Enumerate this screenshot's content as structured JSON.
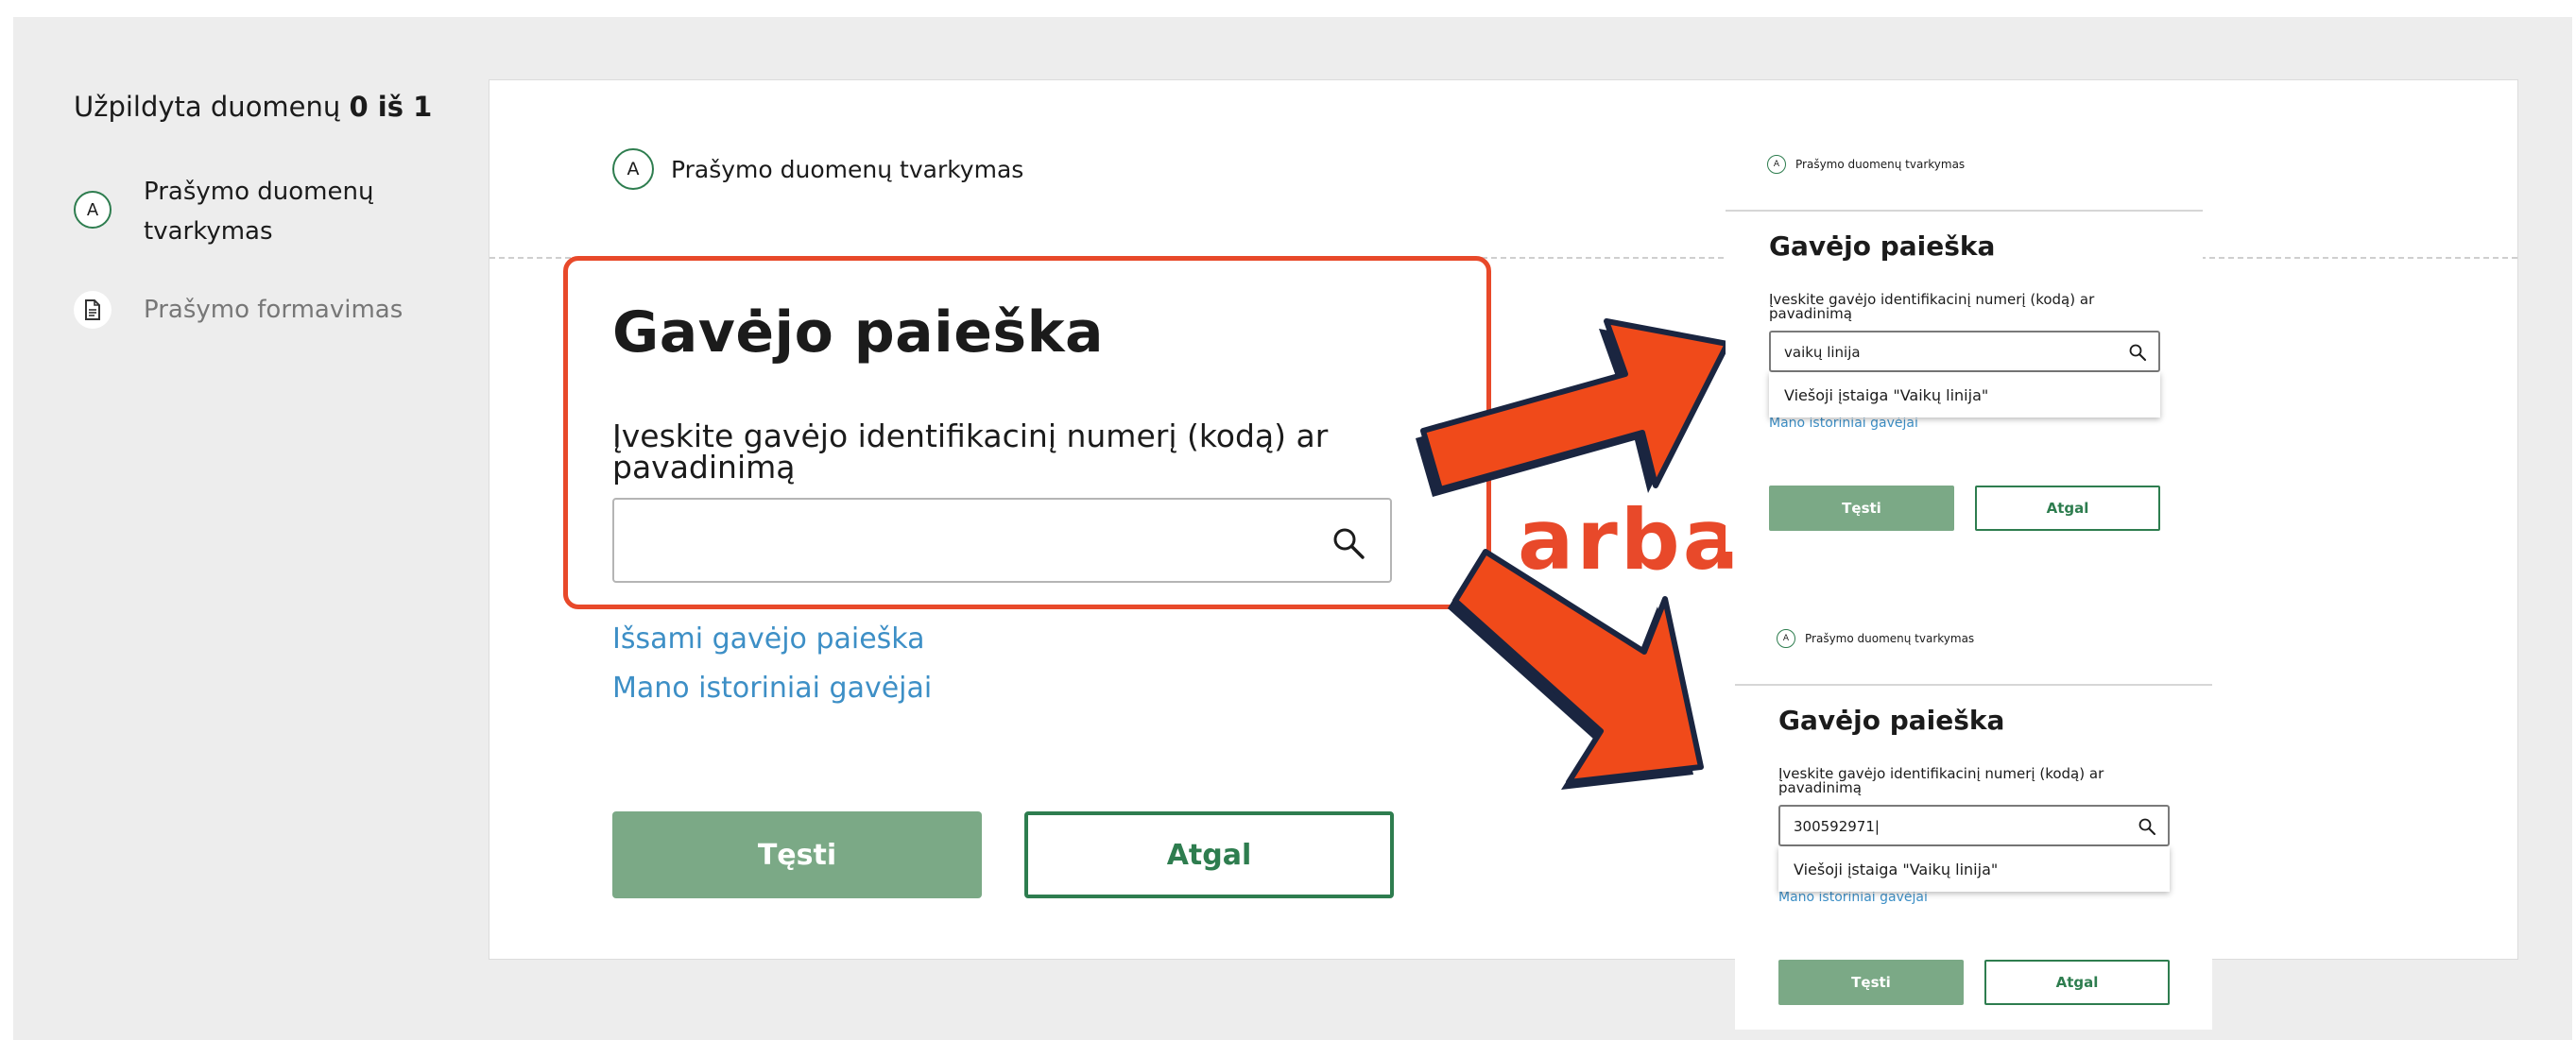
{
  "sidebar": {
    "progress_prefix": "Užpildyta duomenų",
    "progress_value": "0 iš 1",
    "steps": [
      {
        "badge": "A",
        "label": "Prašymo duomenų tvarkymas",
        "icon": "circle-a-icon"
      },
      {
        "label": "Prašymo formavimas",
        "icon": "document-icon"
      }
    ]
  },
  "main": {
    "step_badge": "A",
    "step_title": "Prašymo duomenų tvarkymas",
    "heading": "Gavėjo paieška",
    "field_label": "Įveskite gavėjo identifikacinį numerį (kodą) ar pavadinimą",
    "search_value": "",
    "links": [
      "Išsami gavėjo paieška",
      "Mano istoriniai gavėjai"
    ],
    "primary_button": "Tęsti",
    "secondary_button": "Atgal"
  },
  "annotation": {
    "text": "arba",
    "color": "#e8492a",
    "arrow_color": "#f04a1a",
    "arrow_outline": "#1a2540"
  },
  "previews": [
    {
      "step_badge": "A",
      "step_title": "Prašymo duomenų tvarkymas",
      "heading": "Gavėjo paieška",
      "field_label": "Įveskite gavėjo identifikacinį numerį (kodą) ar pavadinimą",
      "search_value": "vaikų linija",
      "suggestion": "Viešoji įstaiga \"Vaikų linija\"",
      "link": "Mano istoriniai gavėjai",
      "primary_button": "Tęsti",
      "secondary_button": "Atgal"
    },
    {
      "step_badge": "A",
      "step_title": "Prašymo duomenų tvarkymas",
      "heading": "Gavėjo paieška",
      "field_label": "Įveskite gavėjo identifikacinį numerį (kodą) ar pavadinimą",
      "search_value": "300592971|",
      "suggestion": "Viešoji įstaiga \"Vaikų linija\"",
      "link": "Mano istoriniai gavėjai",
      "primary_button": "Tęsti",
      "secondary_button": "Atgal"
    }
  ],
  "colors": {
    "accent_green": "#2e7d4f",
    "button_green": "#7ba986",
    "link_blue": "#3d8fc6",
    "highlight_red": "#e8492a"
  }
}
